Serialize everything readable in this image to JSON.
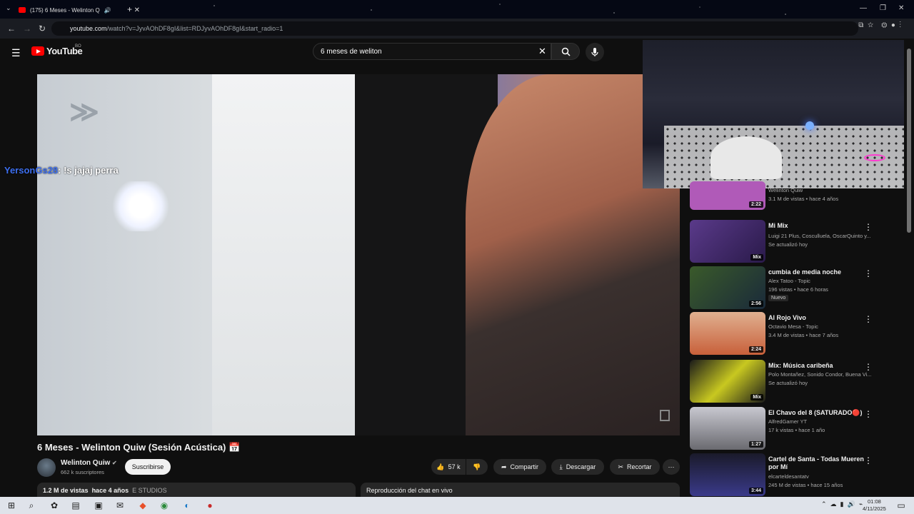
{
  "browser": {
    "tab_title": "(175) 6 Meses - Welinton Q",
    "url_host": "youtube.com",
    "url_path": "/watch?v=JyvAOhDF8gI&list=RDJyvAOhDF8gI&start_radio=1"
  },
  "youtube": {
    "logo_text": "YouTube",
    "country_code": "BO",
    "search_value": "6 meses de weliton"
  },
  "chat_overlay": {
    "user": "YersonGs28",
    "message": ": !s jajaj perra"
  },
  "video": {
    "title": "6 Meses - Welinton Quiw (Sesión Acústica) 📅",
    "channel": "Welinton Quiw",
    "subscribers": "662 k suscriptores",
    "subscribe_label": "Suscribirse",
    "likes": "57 k",
    "share_label": "Compartir",
    "download_label": "Descargar",
    "clip_label": "Recortar",
    "views": "1.2 M de vistas",
    "age": "hace 4 años",
    "tag": "E STUDIOS",
    "chat_replay": "Reproducción del chat en vivo"
  },
  "recommendations": [
    {
      "title": "",
      "channel": "Welinton Quiw",
      "meta": "3.1 M de vistas • hace 4 años",
      "duration": "2:22",
      "color": "#b05ab8"
    },
    {
      "title": "Mi Mix",
      "channel": "Luigi 21 Plus, Cosculluela, OscarQuinto y...",
      "meta": "Se actualizó hoy",
      "duration": "Mix",
      "color": "#5a3a8a"
    },
    {
      "title": "cumbia de media noche",
      "channel": "Alex Tatoo - Topic",
      "meta": "196 vistas • hace 6 horas",
      "badge": "Nuevo",
      "duration": "2:56",
      "color": "#2a4a3a"
    },
    {
      "title": "Al Rojo Vivo",
      "channel": "Octavio Mesa - Topic",
      "meta": "3.4 M de vistas • hace 7 años",
      "duration": "2:24",
      "color": "#c8603a"
    },
    {
      "title": "Mix: Música caribeña",
      "channel": "Polo Montañez, Sonido Condor, Buena Vi...",
      "meta": "Se actualizó hoy",
      "duration": "Mix",
      "color": "#c8c820"
    },
    {
      "title": "El Chavo del 8 (SATURADO🔴)",
      "channel": "AlfredGamer YT",
      "meta": "17 k vistas • hace 1 año",
      "duration": "1:27",
      "color": "#9a9aa0"
    },
    {
      "title": "Cartel de Santa - Todas Mueren por Mí",
      "channel": "elcarteldesantatv",
      "meta": "245 M de vistas • hace 15 años",
      "duration": "3:44",
      "color": "#3a3a8a"
    }
  ],
  "taskbar": {
    "time": "01:08",
    "date": "4/11/2025"
  }
}
